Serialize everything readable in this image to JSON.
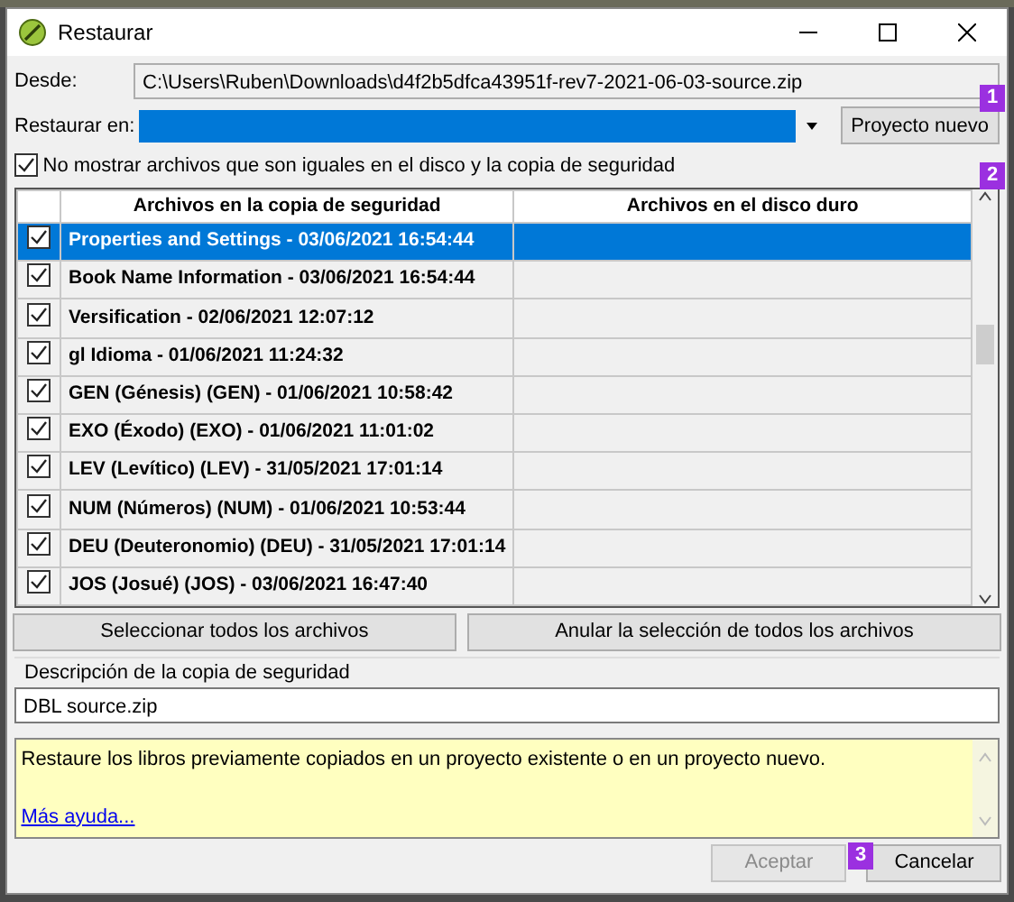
{
  "window": {
    "title": "Restaurar"
  },
  "source": {
    "label": "Desde:",
    "value": "C:\\Users\\Ruben\\Downloads\\d4f2b5dfca43951f-rev7-2021-06-03-source.zip"
  },
  "restore_to": {
    "label": "Restaurar en:"
  },
  "new_project_button": "Proyecto nuevo",
  "hide_identical": {
    "label": "No mostrar archivos que son iguales en el disco y la copia de seguridad",
    "checked": true
  },
  "table": {
    "columns": [
      "Archivos en la copia de seguridad",
      "Archivos en el disco duro"
    ],
    "rows": [
      {
        "backup": "Properties and Settings - 03/06/2021 16:54:44",
        "checked": true,
        "selected": true
      },
      {
        "backup": "Book Name Information - 03/06/2021 16:54:44",
        "checked": true,
        "selected": false
      },
      {
        "backup": "Versification - 02/06/2021 12:07:12",
        "checked": true,
        "selected": false
      },
      {
        "backup": "gl Idioma - 01/06/2021 11:24:32",
        "checked": true,
        "selected": false
      },
      {
        "backup": "GEN (Génesis) (GEN) - 01/06/2021 10:58:42",
        "checked": true,
        "selected": false
      },
      {
        "backup": "EXO (Éxodo) (EXO) - 01/06/2021 11:01:02",
        "checked": true,
        "selected": false
      },
      {
        "backup": "LEV (Levítico) (LEV) - 31/05/2021 17:01:14",
        "checked": true,
        "selected": false
      },
      {
        "backup": "NUM (Números) (NUM) - 01/06/2021 10:53:44",
        "checked": true,
        "selected": false
      },
      {
        "backup": "DEU (Deuteronomio) (DEU) - 31/05/2021 17:01:14",
        "checked": true,
        "selected": false
      },
      {
        "backup": "JOS (Josué) (JOS) - 03/06/2021 16:47:40",
        "checked": true,
        "selected": false
      }
    ]
  },
  "select_all_button": "Seleccionar todos los archivos",
  "deselect_all_button": "Anular la selección de todos los archivos",
  "description": {
    "label": "Descripción de la copia de seguridad",
    "value": "DBL source.zip"
  },
  "help": {
    "text": "Restaure los libros previamente copiados en un proyecto existente o en un proyecto nuevo.",
    "link": "Más ayuda..."
  },
  "buttons": [
    {
      "label": "Aceptar",
      "disabled": true
    },
    {
      "label": "Cancelar",
      "disabled": false
    }
  ],
  "callouts": [
    "1",
    "2",
    "3"
  ]
}
